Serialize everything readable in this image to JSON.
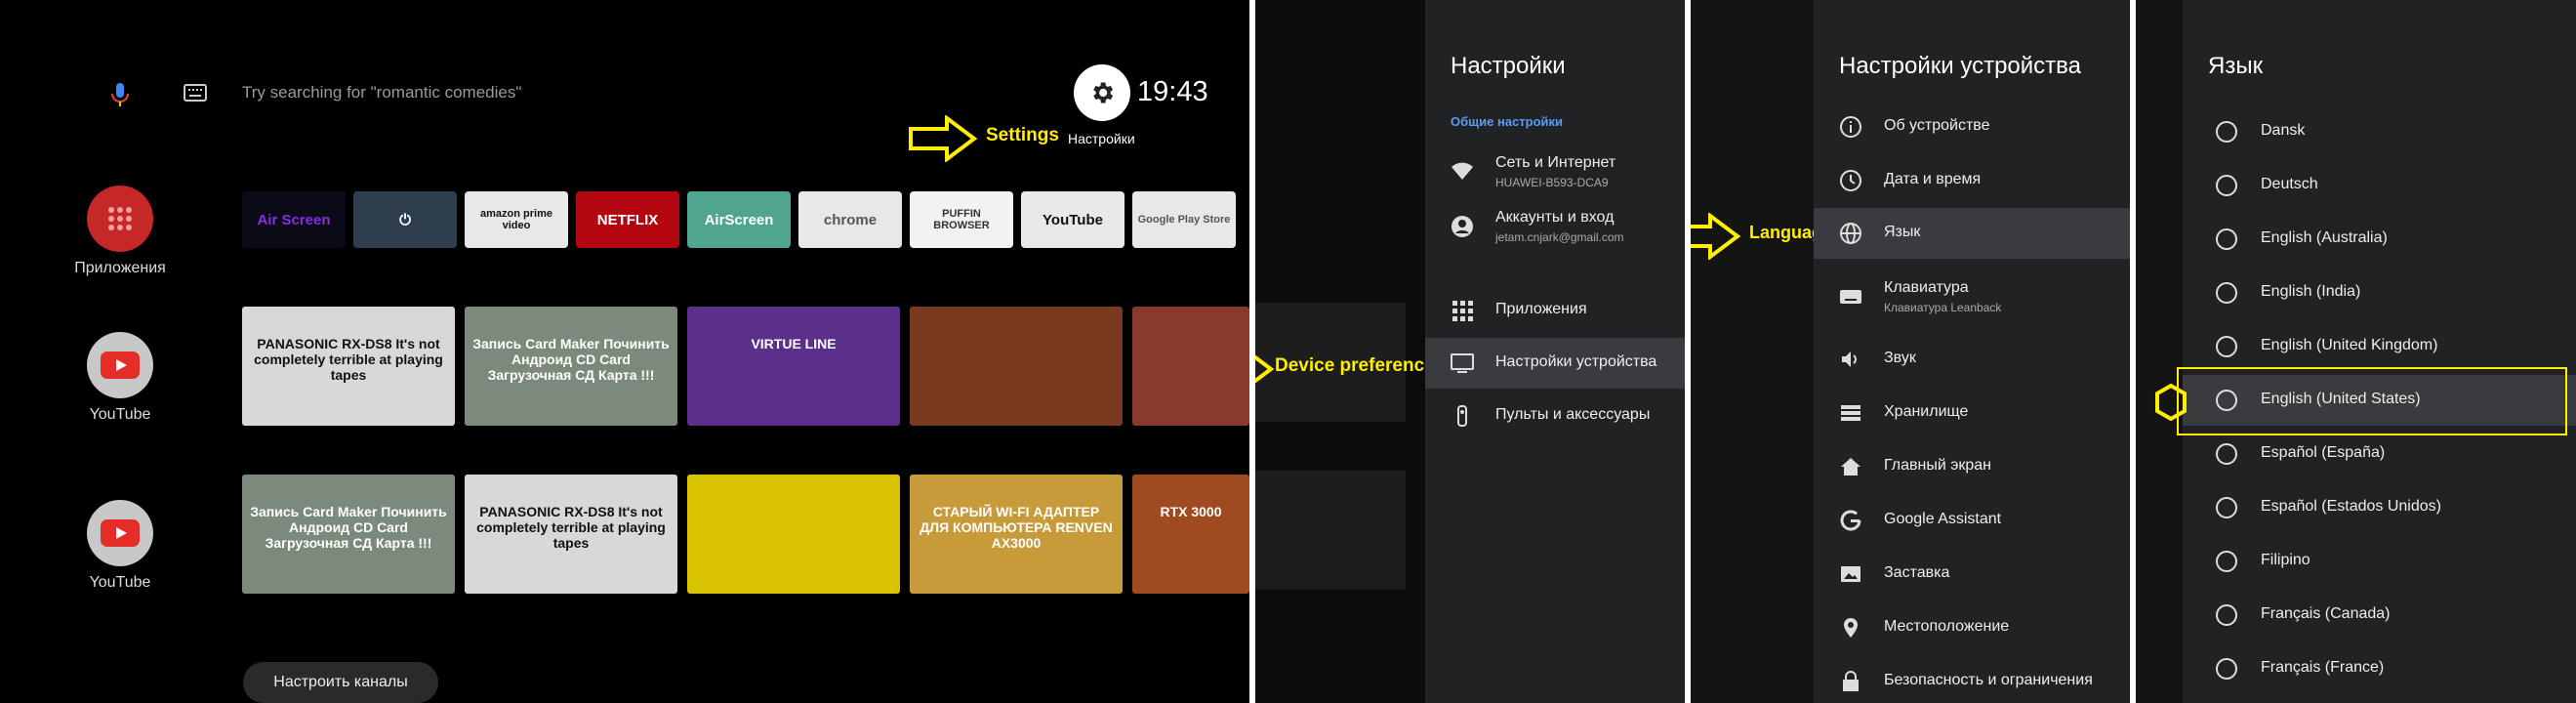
{
  "home": {
    "search_hint": "Try searching for \"romantic comedies\"",
    "clock": "19:43",
    "settings_caption": "Настройки",
    "apps_label": "Приложения",
    "youtube_label_1": "YouTube",
    "youtube_label_2": "YouTube",
    "channels_button": "Настроить каналы",
    "app_chips": [
      {
        "label": "Air Screen",
        "bg": "#0b0b18",
        "fg": "#8a2be2"
      },
      {
        "label": "⏻",
        "bg": "#2f3e4c",
        "fg": "#ffffff"
      },
      {
        "label": "amazon prime video",
        "bg": "#e8e8e8",
        "fg": "#111111"
      },
      {
        "label": "NETFLIX",
        "bg": "#b20710",
        "fg": "#ffffff"
      },
      {
        "label": "AirScreen",
        "bg": "#4fa58d",
        "fg": "#ffffff"
      },
      {
        "label": "chrome",
        "bg": "#e8e8e8",
        "fg": "#555555"
      },
      {
        "label": "PUFFIN BROWSER",
        "bg": "#f2f2f2",
        "fg": "#333333"
      },
      {
        "label": "YouTube",
        "bg": "#e8e8e8",
        "fg": "#111111"
      },
      {
        "label": "Google Play Store",
        "bg": "#e8e8e8",
        "fg": "#555555"
      }
    ],
    "row1_thumbs": [
      {
        "text": "PANASONIC RX-DS8 It's not completely terrible at playing tapes",
        "bg": "#d8d8d8"
      },
      {
        "text": "Запись Card Maker Починить Андроид CD Card Загрузочная СД Карта !!!",
        "bg": "#7c8a7c"
      },
      {
        "text": "VIRTUE LINE",
        "bg": "#5b2f8a"
      },
      {
        "text": "",
        "bg": "#7a3a1f"
      },
      {
        "text": "",
        "bg": "#8a3a2a"
      }
    ],
    "row2_thumbs": [
      {
        "text": "Запись Card Maker Починить Андроид CD Card Загрузочная СД Карта !!!",
        "bg": "#7c8a7c"
      },
      {
        "text": "PANASONIC RX-DS8 It's not completely terrible at playing tapes",
        "bg": "#d8d8d8"
      },
      {
        "text": "",
        "bg": "#d9c200"
      },
      {
        "text": "СТАРЫЙ WI-FI АДАПТЕР ДЛЯ КОМПЬЮТЕРА RENVEN AX3000",
        "bg": "#c79a3a"
      },
      {
        "text": "RTX 3000",
        "bg": "#a04a22"
      }
    ]
  },
  "annotations": {
    "settings": "Settings",
    "device_preferences": "Device preferences",
    "language": "Language"
  },
  "settings_menu": {
    "title": "Настройки",
    "section": "Общие настройки",
    "items": [
      {
        "label": "Сеть и Интернет",
        "sub": "HUAWEI-B593-DCA9",
        "icon": "wifi-icon"
      },
      {
        "label": "Аккаунты и вход",
        "sub": "jetam.cnjark@gmail.com",
        "icon": "account-icon"
      },
      {
        "label": "Приложения",
        "sub": "",
        "icon": "apps-grid-icon"
      },
      {
        "label": "Настройки устройства",
        "sub": "",
        "icon": "tv-icon"
      },
      {
        "label": "Пульты и аксессуары",
        "sub": "",
        "icon": "remote-icon"
      }
    ]
  },
  "device_menu": {
    "title": "Настройки устройства",
    "items": [
      {
        "label": "Об устройстве",
        "sub": ""
      },
      {
        "label": "Дата и время",
        "sub": ""
      },
      {
        "label": "Язык",
        "sub": ""
      },
      {
        "label": "Клавиатура",
        "sub": "Клавиатура Leanback"
      },
      {
        "label": "Звук",
        "sub": ""
      },
      {
        "label": "Хранилище",
        "sub": ""
      },
      {
        "label": "Главный экран",
        "sub": ""
      },
      {
        "label": "Google Assistant",
        "sub": ""
      },
      {
        "label": "Заставка",
        "sub": ""
      },
      {
        "label": "Местоположение",
        "sub": ""
      },
      {
        "label": "Безопасность и ограничения",
        "sub": ""
      }
    ]
  },
  "language_menu": {
    "title": "Язык",
    "options": [
      "Dansk",
      "Deutsch",
      "English (Australia)",
      "English (India)",
      "English (United Kingdom)",
      "English (United States)",
      "Español (España)",
      "Español (Estados Unidos)",
      "Filipino",
      "Français (Canada)",
      "Français (France)"
    ]
  },
  "colors": {
    "annotation": "#ffee00",
    "section_header": "#5b9cf5",
    "drawer_bg": "#212224"
  }
}
